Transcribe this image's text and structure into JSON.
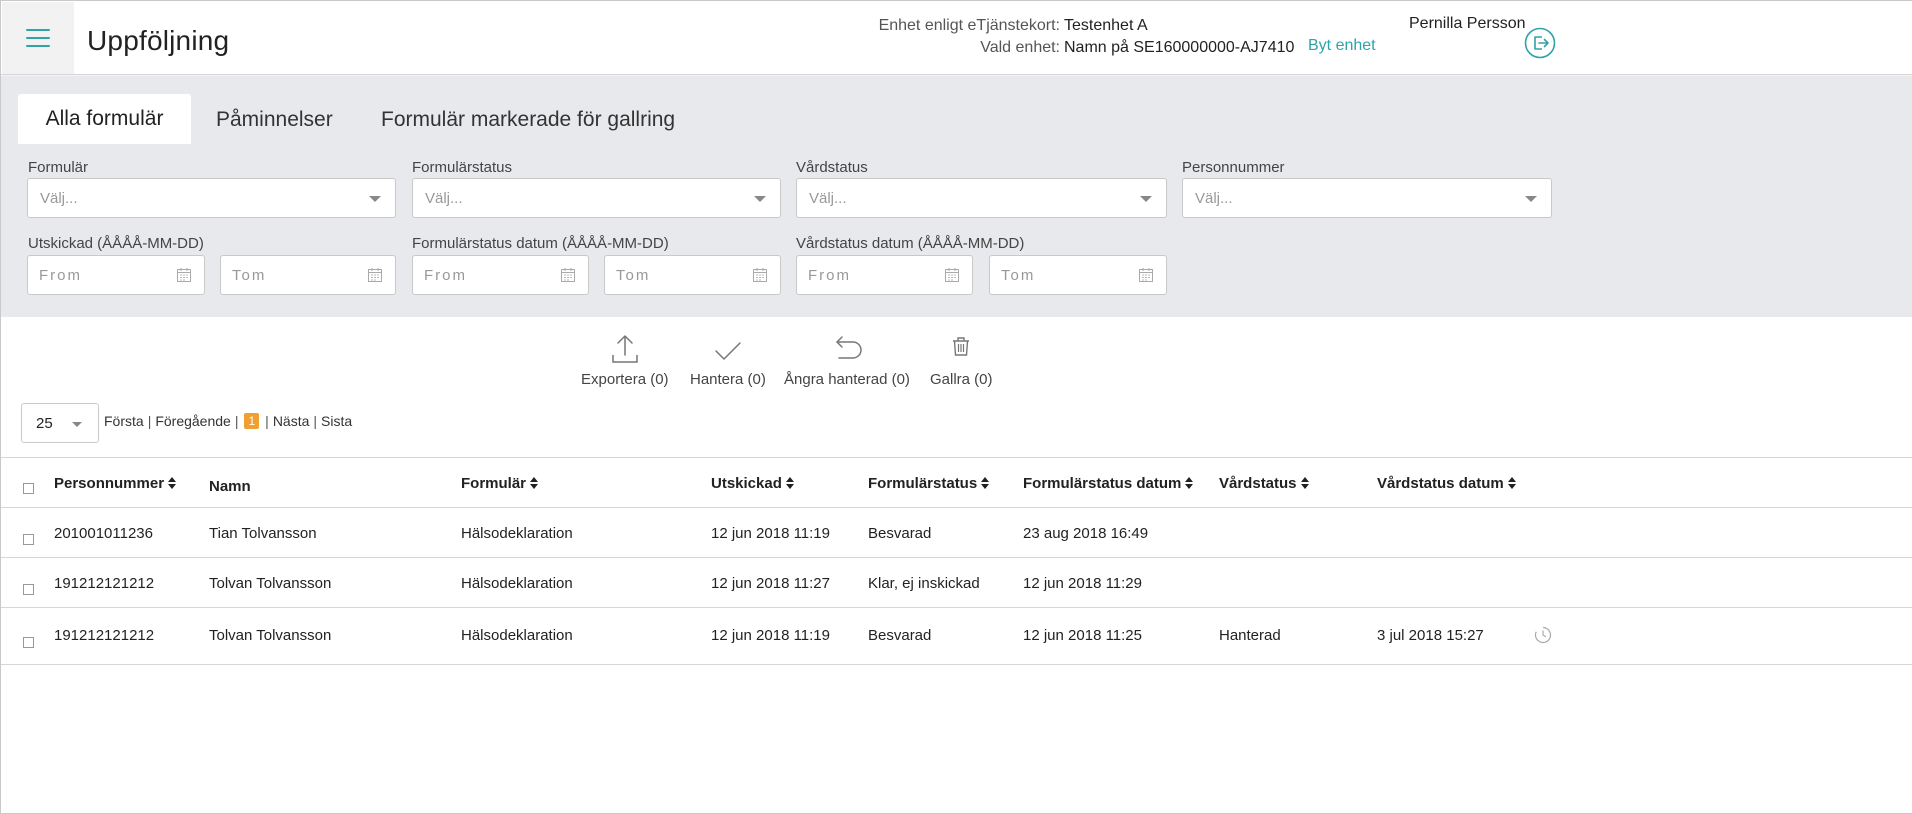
{
  "header": {
    "title": "Uppföljning",
    "unit_card_label": "Enhet enligt eTjänstekort:",
    "unit_card_value": "Testenhet A",
    "selected_unit_label": "Vald enhet:",
    "selected_unit_value": "Namn på SE160000000-AJ7410",
    "switch_unit": "Byt enhet",
    "user_name": "Pernilla Persson"
  },
  "tabs": [
    {
      "label": "Alla formulär",
      "active": true
    },
    {
      "label": "Påminnelser",
      "active": false
    },
    {
      "label": "Formulär markerade för gallring",
      "active": false
    }
  ],
  "filters": {
    "form_label": "Formulär",
    "form_status_label": "Formulärstatus",
    "care_status_label": "Vårdstatus",
    "personal_number_label": "Personnummer",
    "select_placeholder": "Välj...",
    "sent_label": "Utskickad (ÅÅÅÅ-MM-DD)",
    "form_status_date_label": "Formulärstatus datum (ÅÅÅÅ-MM-DD)",
    "care_status_date_label": "Vårdstatus datum (ÅÅÅÅ-MM-DD)",
    "from_placeholder": "From",
    "to_placeholder": "Tom"
  },
  "actions": {
    "export": "Exportera (0)",
    "handle": "Hantera (0)",
    "undo_handled": "Ångra hanterad (0)",
    "purge": "Gallra (0)"
  },
  "pagination": {
    "page_size": "25",
    "first": "Första",
    "previous": "Föregående",
    "current": "1",
    "next": "Nästa",
    "last": "Sista",
    "separator": "|"
  },
  "table": {
    "headers": {
      "personal_number": "Personnummer",
      "name": "Namn",
      "form": "Formulär",
      "sent": "Utskickad",
      "form_status": "Formulärstatus",
      "form_status_date": "Formulärstatus datum",
      "care_status": "Vårdstatus",
      "care_status_date": "Vårdstatus datum"
    },
    "rows": [
      {
        "personal_number": "201001011236",
        "name": "Tian Tolvansson",
        "form": "Hälsodeklaration",
        "sent": "12 jun 2018 11:19",
        "form_status": "Besvarad",
        "form_status_date": "23 aug 2018 16:49",
        "care_status": "",
        "care_status_date": ""
      },
      {
        "personal_number": "191212121212",
        "name": "Tolvan Tolvansson",
        "form": "Hälsodeklaration",
        "sent": "12 jun 2018 11:27",
        "form_status": "Klar, ej inskickad",
        "form_status_date": "12 jun 2018 11:29",
        "care_status": "",
        "care_status_date": ""
      },
      {
        "personal_number": "191212121212",
        "name": "Tolvan Tolvansson",
        "form": "Hälsodeklaration",
        "sent": "12 jun 2018 11:19",
        "form_status": "Besvarad",
        "form_status_date": "12 jun 2018 11:25",
        "care_status": "Hanterad",
        "care_status_date": "3 jul 2018 15:27"
      }
    ]
  },
  "icons": {
    "menu": "hamburger-icon",
    "logout": "logout-icon",
    "calendar": "calendar-icon",
    "export": "upload-icon",
    "handle": "check-icon",
    "undo": "undo-arrow-icon",
    "purge": "trash-icon",
    "history": "clock-icon"
  },
  "colors": {
    "accent": "#2fa3a8",
    "current_page": "#f0a030",
    "filter_background": "#e7e9ec"
  }
}
